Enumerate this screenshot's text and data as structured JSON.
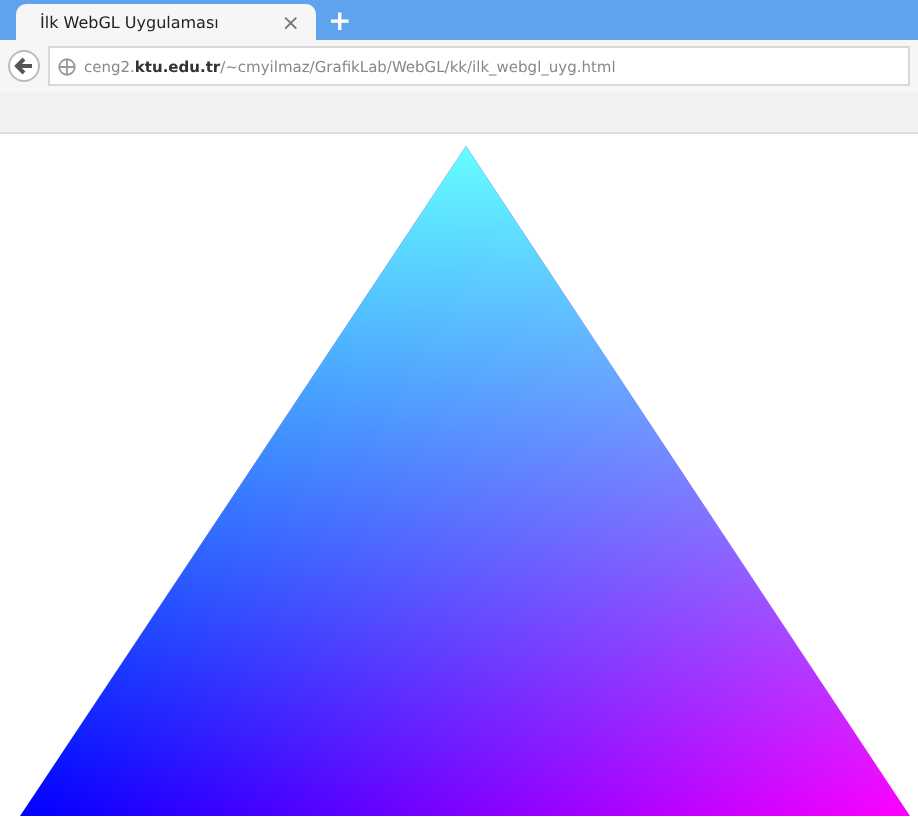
{
  "tabs": [
    {
      "title": "İlk WebGL Uygulaması",
      "close": "×",
      "selected": true
    }
  ],
  "new_tab": "+",
  "address_bar": {
    "url": "ceng2.**ktu.edu.tr**/~cmyilmaz/GrafikLab/WebGL/kk/ilk_webgl_uyg.html"
  }
}
